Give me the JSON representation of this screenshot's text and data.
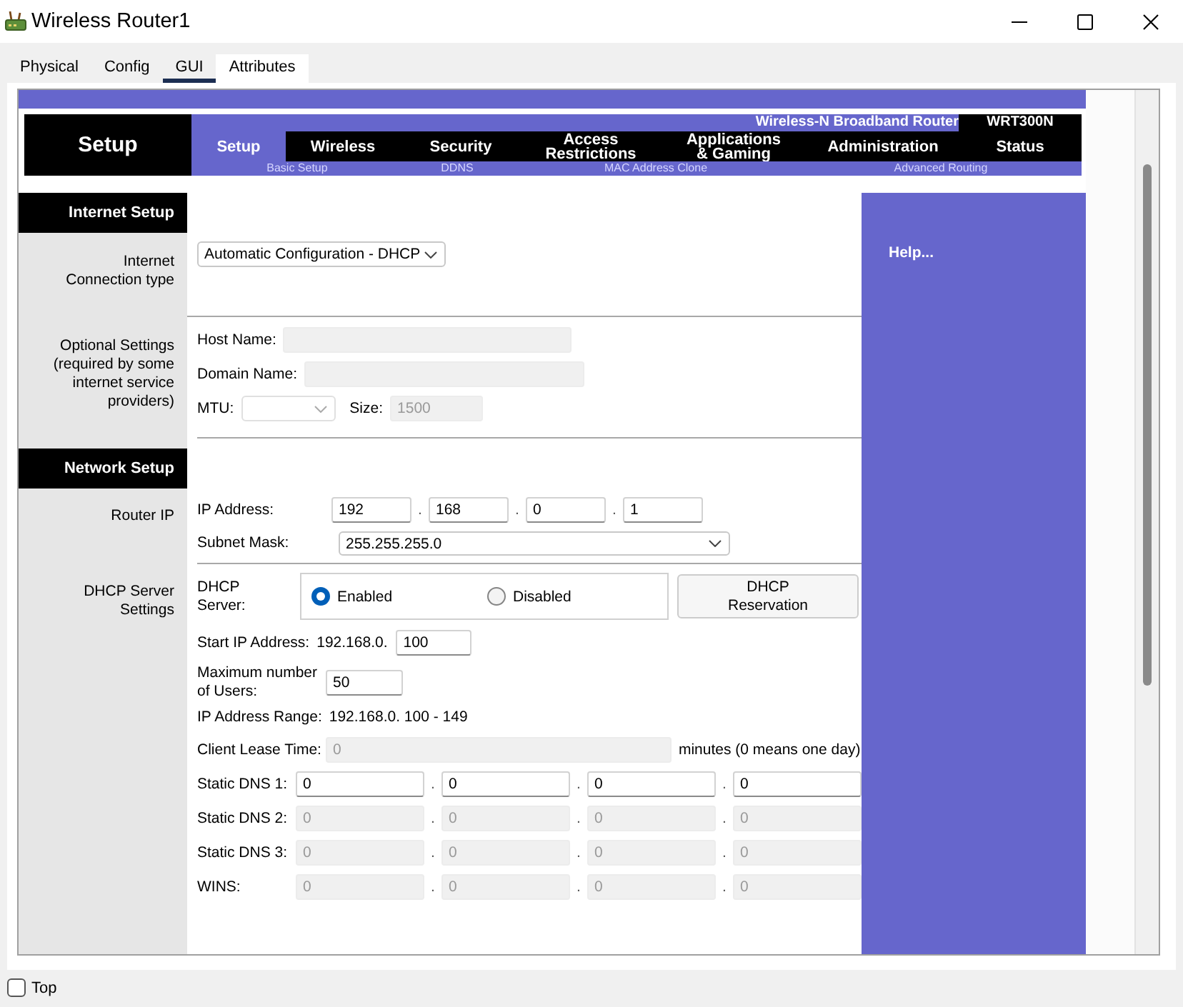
{
  "window": {
    "title": "Wireless Router1"
  },
  "tabs": [
    {
      "label": "Physical",
      "selected": false,
      "hovered": false
    },
    {
      "label": "Config",
      "selected": false,
      "hovered": false
    },
    {
      "label": "GUI",
      "selected": true,
      "hovered": false
    },
    {
      "label": "Attributes",
      "selected": false,
      "hovered": true
    }
  ],
  "router_page": {
    "header": {
      "title": "Setup",
      "product": "Wireless-N Broadband Router",
      "model": "WRT300N",
      "menu": [
        {
          "label": "Setup",
          "selected": true
        },
        {
          "label": "Wireless",
          "selected": false
        },
        {
          "label": "Security",
          "selected": false
        },
        {
          "label": "Access\nRestrictions",
          "selected": false
        },
        {
          "label": "Applications\n& Gaming",
          "selected": false
        },
        {
          "label": "Administration",
          "selected": false
        },
        {
          "label": "Status",
          "selected": false
        }
      ],
      "submenu": [
        "Basic Setup",
        "DDNS",
        "MAC Address Clone",
        "Advanced Routing"
      ]
    },
    "internet_setup": {
      "heading": "Internet Setup",
      "connection_type": {
        "label": "Internet\nConnection type",
        "value": "Automatic Configuration - DHCP"
      },
      "optional_settings": {
        "label": "Optional Settings\n(required by some\ninternet service\nproviders)",
        "host_name": {
          "label": "Host Name:",
          "disabled": true
        },
        "domain_name": {
          "label": "Domain Name:",
          "disabled": true
        },
        "mtu": {
          "label": "MTU:",
          "disabled": true
        },
        "size": {
          "label": "Size:",
          "value": "1500",
          "disabled": true
        }
      }
    },
    "network_setup": {
      "heading": "Network Setup",
      "router_ip": {
        "label": "Router IP",
        "ip_address": {
          "label": "IP Address:",
          "octets": [
            "192",
            "168",
            "0",
            "1"
          ],
          "separator": "."
        },
        "subnet_mask": {
          "label": "Subnet Mask:",
          "value": "255.255.255.0"
        }
      },
      "dhcp": {
        "label": "DHCP Server\nSettings",
        "server": {
          "label": "DHCP\nServer:",
          "options": [
            {
              "label": "Enabled",
              "selected": true
            },
            {
              "label": "Disabled",
              "selected": false
            }
          ]
        },
        "reservation_button": "DHCP\nReservation",
        "start_ip": {
          "label": "Start IP Address:",
          "prefix": "192.168.0.",
          "value": "100"
        },
        "max_users": {
          "label": "Maximum number\nof Users:",
          "value": "50"
        },
        "ip_range": {
          "label": "IP Address Range:",
          "value": "192.168.0. 100 - 149"
        },
        "lease_time": {
          "label": "Client Lease Time:",
          "value": "0",
          "disabled": true,
          "unit": "minutes (0 means one day)"
        },
        "dns": [
          {
            "label": "Static DNS 1:",
            "octets": [
              "0",
              "0",
              "0",
              "0"
            ],
            "separator": ".",
            "disabled": false
          },
          {
            "label": "Static DNS 2:",
            "octets": [
              "0",
              "0",
              "0",
              "0"
            ],
            "separator": ".",
            "disabled": true
          },
          {
            "label": "Static DNS 3:",
            "octets": [
              "0",
              "0",
              "0",
              "0"
            ],
            "separator": ".",
            "disabled": true
          },
          {
            "label": "WINS:",
            "octets": [
              "0",
              "0",
              "0",
              "0"
            ],
            "separator": ".",
            "disabled": true
          }
        ]
      }
    },
    "help": "Help..."
  },
  "top_checkbox": {
    "label": "Top",
    "checked": false
  }
}
